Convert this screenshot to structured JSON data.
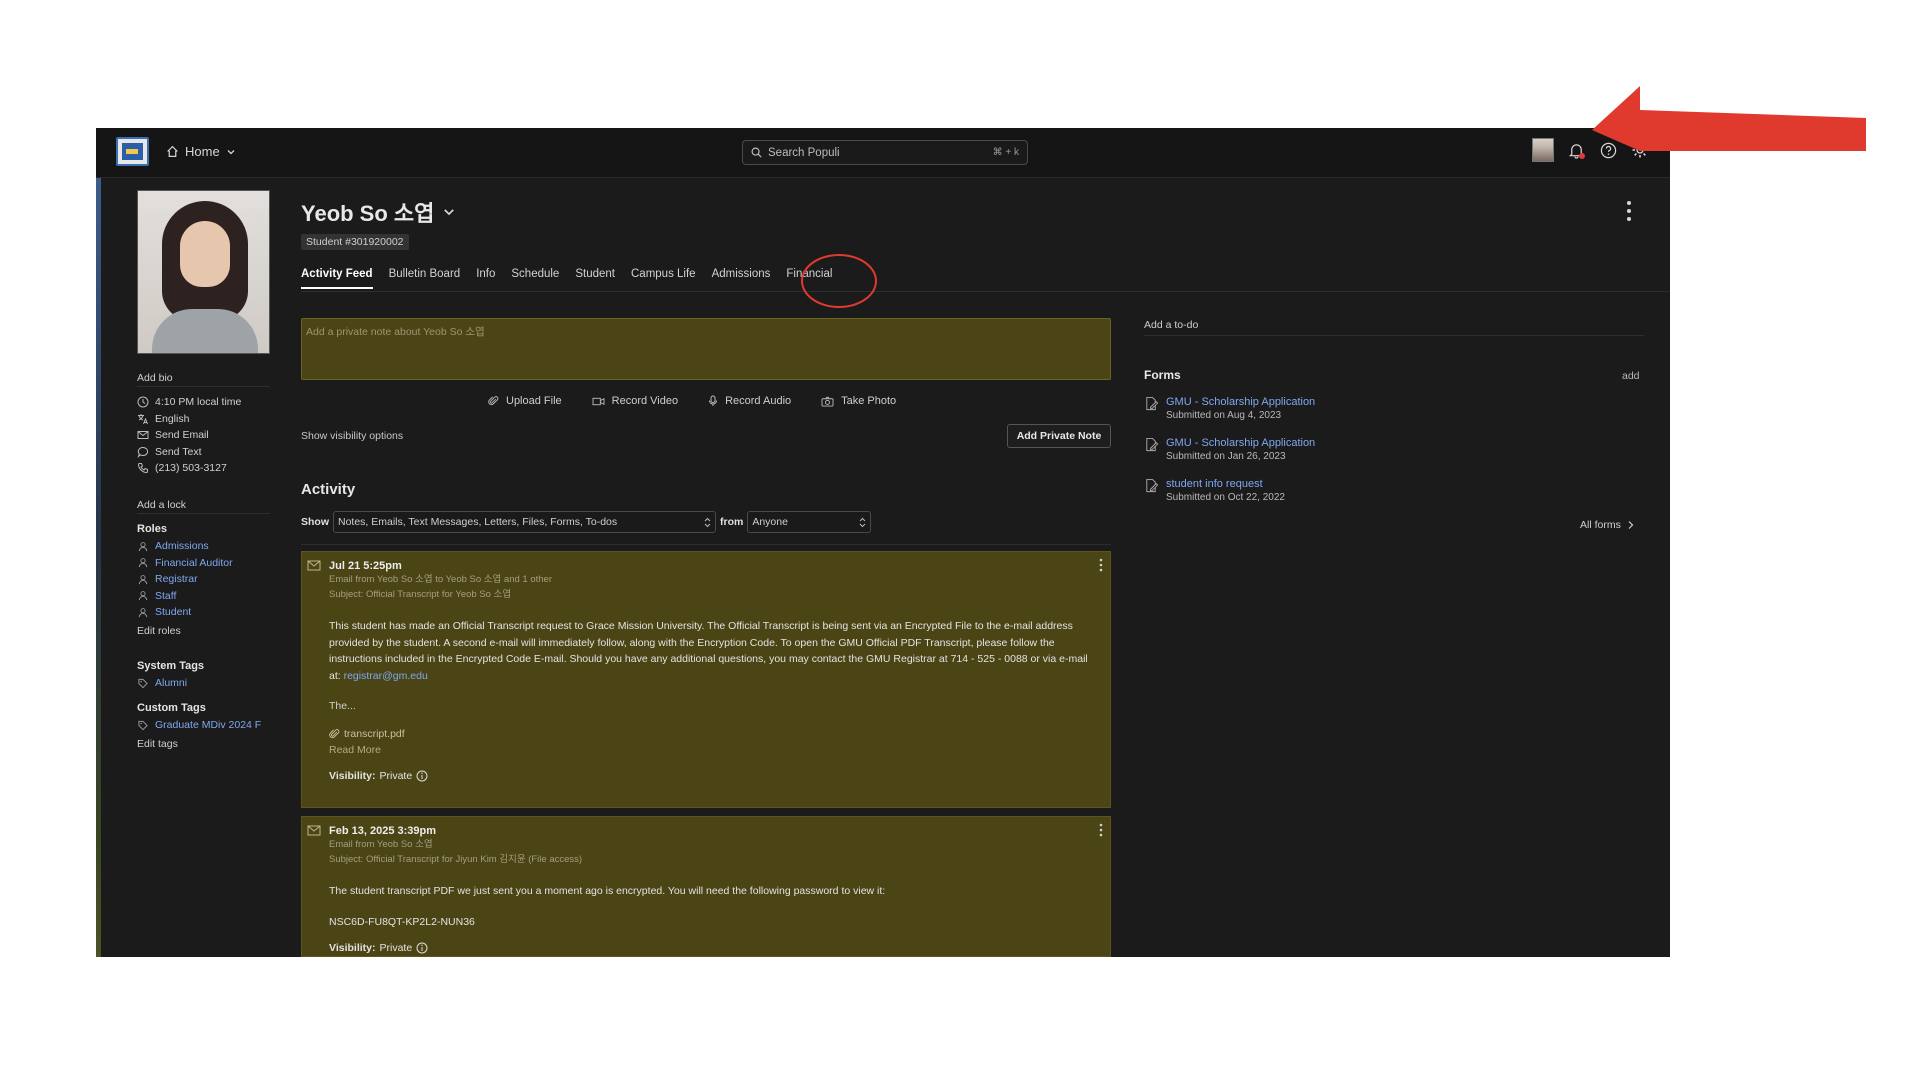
{
  "topbar": {
    "home_label": "Home",
    "search_placeholder": "Search Populi",
    "search_shortcut": "⌘ + k"
  },
  "profile": {
    "name": "Yeob So 소엽",
    "student_id": "Student #301920002",
    "add_bio": "Add bio",
    "details": [
      {
        "icon": "clock-icon",
        "text": "4:10 PM local time"
      },
      {
        "icon": "language-icon",
        "text": "English"
      },
      {
        "icon": "mail-icon",
        "text": "Send Email"
      },
      {
        "icon": "chat-icon",
        "text": "Send Text"
      },
      {
        "icon": "phone-icon",
        "text": "(213) 503-3127"
      }
    ],
    "add_lock": "Add a lock",
    "roles_title": "Roles",
    "roles": [
      "Admissions",
      "Financial Auditor",
      "Registrar",
      "Staff",
      "Student"
    ],
    "edit_roles": "Edit roles",
    "system_tags_title": "System Tags",
    "system_tags": [
      "Alumni"
    ],
    "custom_tags_title": "Custom Tags",
    "custom_tags": [
      "Graduate MDiv 2024 F"
    ],
    "edit_tags": "Edit tags"
  },
  "tabs": [
    "Activity Feed",
    "Bulletin Board",
    "Info",
    "Schedule",
    "Student",
    "Campus Life",
    "Admissions",
    "Financial"
  ],
  "active_tab": "Activity Feed",
  "composer": {
    "placeholder": "Add a private note about Yeob So 소엽",
    "actions": [
      {
        "icon": "paperclip-icon",
        "label": "Upload File"
      },
      {
        "icon": "video-icon",
        "label": "Record Video"
      },
      {
        "icon": "microphone-icon",
        "label": "Record Audio"
      },
      {
        "icon": "camera-icon",
        "label": "Take Photo"
      }
    ],
    "visibility_options": "Show visibility options",
    "add_note_button": "Add Private Note"
  },
  "activity": {
    "title": "Activity",
    "show_label": "Show",
    "show_value": "Notes, Emails, Text Messages, Letters, Files, Forms, To-dos",
    "from_label": "from",
    "from_value": "Anyone",
    "items": [
      {
        "date": "Jul 21 5:25pm",
        "meta1": "Email from Yeob So 소엽 to Yeob So 소엽 and 1 other",
        "meta2": "Subject: Official Transcript for Yeob So 소엽",
        "body": "This student has made an Official Transcript request to Grace Mission University. The Official Transcript is being sent via an Encrypted File to the e-mail address provided by the student. A second e-mail will immediately follow, along with the Encryption Code. To open the GMU Official PDF Transcript, please follow the instructions included in the Encrypted Code E-mail. Should you have any additional questions, you may contact the GMU Registrar at 714 - 525 - 0088 or via e-mail at: ",
        "email": "registrar@gm.edu",
        "more": "The...",
        "attachment": "transcript.pdf",
        "read_more": "Read More",
        "visibility_label": "Visibility:",
        "visibility_value": "Private"
      },
      {
        "date": "Feb 13, 2025 3:39pm",
        "meta1": "Email from Yeob So 소엽",
        "meta2": "Subject: Official Transcript for Jiyun Kim 김지윤 (File access)",
        "body": "The student transcript PDF we just sent you a moment ago is encrypted. You will need the following password to view it:",
        "code": "NSC6D-FU8QT-KP2L2-NUN36",
        "visibility_label": "Visibility:",
        "visibility_value": "Private"
      }
    ]
  },
  "right": {
    "todo": "Add a to-do",
    "forms_title": "Forms",
    "forms_add": "add",
    "forms": [
      {
        "title": "GMU - Scholarship Application",
        "submitted": "Submitted on Aug 4, 2023"
      },
      {
        "title": "GMU - Scholarship Application",
        "submitted": "Submitted on Jan 26, 2023"
      },
      {
        "title": "student info request",
        "submitted": "Submitted on Oct 22, 2022"
      }
    ],
    "all_forms": "All forms"
  },
  "colors": {
    "app_bg": "#1b1b1b",
    "note_bg": "#4b4417",
    "link": "#7fa8f0",
    "annotation_red": "#e03a2f"
  }
}
